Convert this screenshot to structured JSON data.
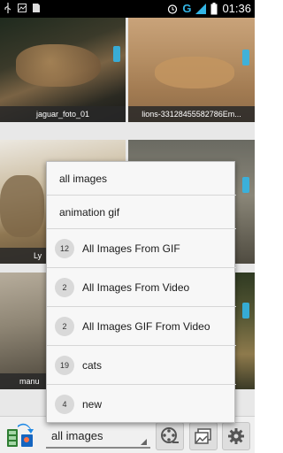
{
  "status_bar": {
    "time": "01:36",
    "network_letter": "G",
    "icons": [
      "usb-icon",
      "image-notification-icon",
      "sd-card-icon",
      "alarm-icon",
      "network-g-icon",
      "signal-icon",
      "battery-icon"
    ]
  },
  "grid": {
    "tiles": [
      {
        "caption": "jaguar_foto_01",
        "image": "jaguar"
      },
      {
        "caption": "lions-33128455582786Em...",
        "image": "lions"
      },
      {
        "caption": "Ly",
        "image": "lynx"
      },
      {
        "caption": "",
        "image": "cat-sitting"
      },
      {
        "caption": "manu",
        "image": "manul"
      },
      {
        "caption": "",
        "image": "cat-grass"
      }
    ]
  },
  "dropdown": {
    "items": [
      {
        "label": "all images"
      },
      {
        "label": "animation gif"
      },
      {
        "label": "All Images From GIF",
        "count": "12"
      },
      {
        "label": "All Images From Video",
        "count": "2"
      },
      {
        "label": "All Images GIF From Video",
        "count": "2"
      },
      {
        "label": "cats",
        "count": "19"
      },
      {
        "label": "new",
        "count": "4"
      }
    ]
  },
  "bottom_bar": {
    "selected_album": "all images",
    "buttons": [
      "film-reel-icon",
      "image-stack-icon",
      "gear-icon"
    ]
  },
  "colors": {
    "accent": "#33b5e5",
    "popup_bg": "#f7f7f7",
    "statusbar_bg": "#000000"
  }
}
